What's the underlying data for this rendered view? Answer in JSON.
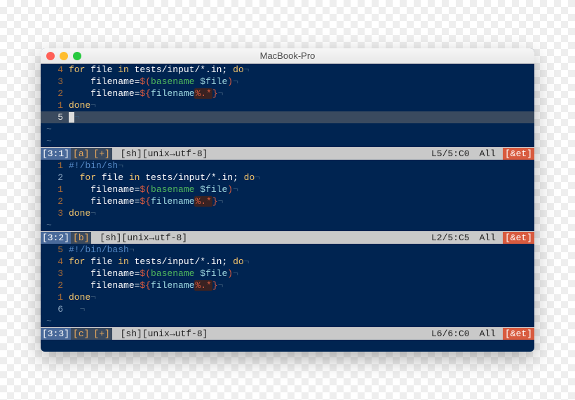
{
  "window": {
    "title": "MacBook-Pro"
  },
  "panes": [
    {
      "status": {
        "id": "[3:1]",
        "buf": "[a]",
        "modified": "[+]",
        "ft": " [sh][unix→utf-8]",
        "pos": "L5/5:C0",
        "pct": "All",
        "flags": "[&et]"
      },
      "lines": [
        {
          "g": "4",
          "gt": "rel",
          "tokens": [
            {
              "t": "for",
              "c": "kw"
            },
            {
              "t": " file "
            },
            {
              "t": "in",
              "c": "kw"
            },
            {
              "t": " tests/input/*.in; "
            },
            {
              "t": "do",
              "c": "kw"
            },
            {
              "t": "¬",
              "c": "invis"
            }
          ]
        },
        {
          "g": "3",
          "gt": "rel",
          "tokens": [
            {
              "t": "    filename="
            },
            {
              "t": "$(",
              "c": "brace"
            },
            {
              "t": "basename",
              "c": "func"
            },
            {
              "t": " "
            },
            {
              "t": "$file",
              "c": "var"
            },
            {
              "t": ")",
              "c": "brace"
            },
            {
              "t": "¬",
              "c": "invis"
            }
          ]
        },
        {
          "g": "2",
          "gt": "rel",
          "tokens": [
            {
              "t": "    filename="
            },
            {
              "t": "${",
              "c": "brace"
            },
            {
              "t": "filename",
              "c": "var"
            },
            {
              "t": "%.*",
              "c": "pct"
            },
            {
              "t": "}",
              "c": "brace"
            },
            {
              "t": "¬",
              "c": "invis"
            }
          ]
        },
        {
          "g": "1",
          "gt": "rel",
          "tokens": [
            {
              "t": "done",
              "c": "kw"
            },
            {
              "t": "¬",
              "c": "invis"
            }
          ]
        },
        {
          "g": "5",
          "gt": "abs",
          "cursor": true,
          "tokens": [
            {
              "t": "",
              "cursor": true
            },
            {
              "t": "¬",
              "c": "invis"
            }
          ]
        }
      ],
      "tildes": 2
    },
    {
      "status": {
        "id": "[3:2]",
        "buf": "[b]",
        "modified": "",
        "ft": " [sh][unix→utf-8]",
        "pos": "L2/5:C5",
        "pct": "All",
        "flags": "[&et]"
      },
      "lines": [
        {
          "g": "1",
          "gt": "rel",
          "tokens": [
            {
              "t": "#!/bin/sh",
              "c": "shebang"
            },
            {
              "t": "¬",
              "c": "invis"
            }
          ]
        },
        {
          "g": "2",
          "gt": "abs-alt",
          "tokens": [
            {
              "t": "  "
            },
            {
              "t": "for",
              "c": "kw"
            },
            {
              "t": " file "
            },
            {
              "t": "in",
              "c": "kw"
            },
            {
              "t": " tests/input/*.in; "
            },
            {
              "t": "do",
              "c": "kw"
            },
            {
              "t": "¬",
              "c": "invis"
            }
          ]
        },
        {
          "g": "1",
          "gt": "rel",
          "tokens": [
            {
              "t": "    filename="
            },
            {
              "t": "$(",
              "c": "brace"
            },
            {
              "t": "basename",
              "c": "func"
            },
            {
              "t": " "
            },
            {
              "t": "$file",
              "c": "var"
            },
            {
              "t": ")",
              "c": "brace"
            },
            {
              "t": "¬",
              "c": "invis"
            }
          ]
        },
        {
          "g": "2",
          "gt": "rel",
          "tokens": [
            {
              "t": "    filename="
            },
            {
              "t": "${",
              "c": "brace"
            },
            {
              "t": "filename",
              "c": "var"
            },
            {
              "t": "%.*",
              "c": "pct"
            },
            {
              "t": "}",
              "c": "brace"
            },
            {
              "t": "¬",
              "c": "invis"
            }
          ]
        },
        {
          "g": "3",
          "gt": "rel",
          "tokens": [
            {
              "t": "done",
              "c": "kw"
            },
            {
              "t": "¬",
              "c": "invis"
            }
          ]
        }
      ],
      "tildes": 1
    },
    {
      "status": {
        "id": "[3:3]",
        "buf": "[c]",
        "modified": "[+]",
        "ft": " [sh][unix→utf-8]",
        "pos": "L6/6:C0",
        "pct": "All",
        "flags": "[&et]"
      },
      "lines": [
        {
          "g": "5",
          "gt": "rel",
          "tokens": [
            {
              "t": "#!/bin/bash",
              "c": "shebang"
            },
            {
              "t": "¬",
              "c": "invis"
            }
          ]
        },
        {
          "g": "4",
          "gt": "rel",
          "tokens": [
            {
              "t": "for",
              "c": "kw"
            },
            {
              "t": " file "
            },
            {
              "t": "in",
              "c": "kw"
            },
            {
              "t": " tests/input/*.in; "
            },
            {
              "t": "do",
              "c": "kw"
            },
            {
              "t": "¬",
              "c": "invis"
            }
          ]
        },
        {
          "g": "3",
          "gt": "rel",
          "tokens": [
            {
              "t": "    filename="
            },
            {
              "t": "$(",
              "c": "brace"
            },
            {
              "t": "basename",
              "c": "func"
            },
            {
              "t": " "
            },
            {
              "t": "$file",
              "c": "var"
            },
            {
              "t": ")",
              "c": "brace"
            },
            {
              "t": "¬",
              "c": "invis"
            }
          ]
        },
        {
          "g": "2",
          "gt": "rel",
          "tokens": [
            {
              "t": "    filename="
            },
            {
              "t": "${",
              "c": "brace"
            },
            {
              "t": "filename",
              "c": "var"
            },
            {
              "t": "%.*",
              "c": "pct"
            },
            {
              "t": "}",
              "c": "brace"
            },
            {
              "t": "¬",
              "c": "invis"
            }
          ]
        },
        {
          "g": "1",
          "gt": "rel",
          "tokens": [
            {
              "t": "done",
              "c": "kw"
            },
            {
              "t": "¬",
              "c": "invis"
            }
          ]
        },
        {
          "g": "6",
          "gt": "abs-alt",
          "tokens": [
            {
              "t": "  ¬",
              "c": "invis"
            }
          ]
        }
      ],
      "tildes": 1
    }
  ],
  "cmdline": " "
}
